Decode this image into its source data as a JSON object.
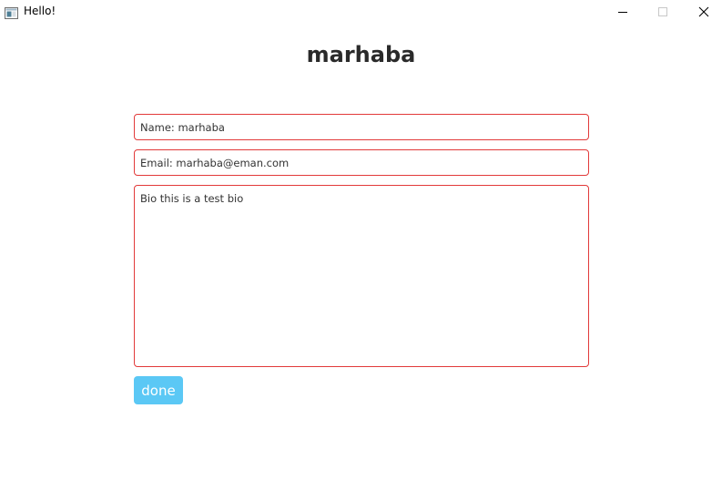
{
  "window": {
    "title": "Hello!",
    "icon": "application-window-icon",
    "controls": {
      "minimize_icon": "minimize-icon",
      "maximize_icon": "maximize-icon",
      "close_icon": "close-icon"
    }
  },
  "form": {
    "heading": "marhaba",
    "name_value": "Name: marhaba",
    "email_value": "Email: marhaba@eman.com",
    "bio_value": "Bio this is a test bio",
    "done_label": "done"
  },
  "colors": {
    "field_border": "#e23a3a",
    "button_bg": "#5bc8f5",
    "button_text": "#ffffff",
    "heading": "#2a2a2a"
  }
}
